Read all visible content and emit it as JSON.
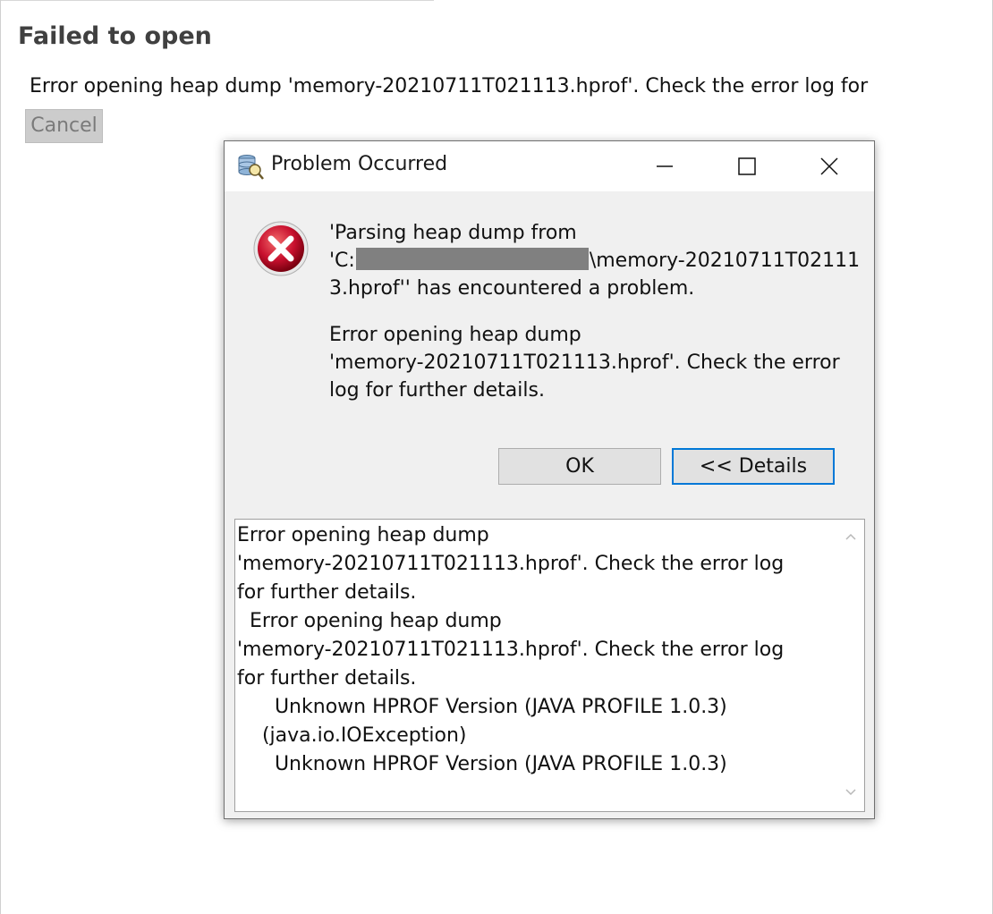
{
  "background": {
    "title": "Failed to open",
    "message": "Error opening heap dump 'memory-20210711T021113.hprof'. Check the error log for",
    "cancel_label": "Cancel"
  },
  "dialog": {
    "title": "Problem Occurred",
    "app_icon": "eclipse-memory-analyzer-icon",
    "error_icon": "error-x-icon",
    "message_lines": {
      "l1": "'Parsing heap dump from",
      "l2_prefix": "'C:",
      "l2_suffix": "\\memory-20210711T02111",
      "l3": "3.hprof'' has encountered a problem."
    },
    "detail_message_lines": [
      "Error opening heap dump",
      "'memory-20210711T021113.hprof'. Check the error",
      "log for further details."
    ],
    "ok_label": "OK",
    "details_label": "<< Details",
    "details_lines": [
      "Error opening heap dump",
      "'memory-20210711T021113.hprof'. Check the error log",
      "for further details.",
      "  Error opening heap dump",
      "'memory-20210711T021113.hprof'. Check the error log",
      "for further details.",
      "      Unknown HPROF Version (JAVA PROFILE 1.0.3)",
      "    (java.io.IOException)",
      "      Unknown HPROF Version (JAVA PROFILE 1.0.3)"
    ]
  },
  "colors": {
    "accent": "#0078d7",
    "error_red": "#c8102e",
    "redaction": "#808080"
  }
}
